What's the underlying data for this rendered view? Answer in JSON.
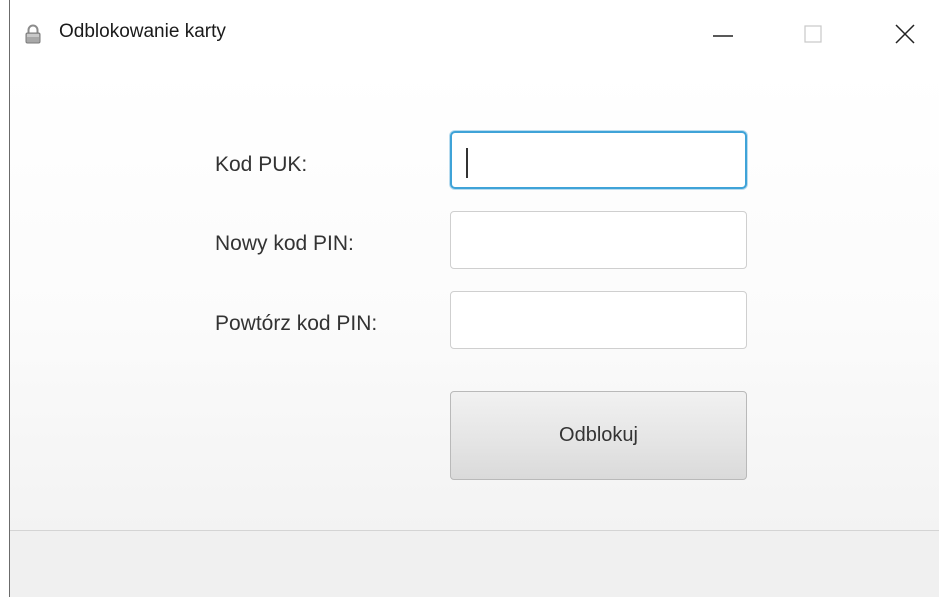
{
  "window": {
    "title": "Odblokowanie karty",
    "icon": "padlock-icon",
    "controls": {
      "minimize": "minimize-icon",
      "maximize": "maximize-icon",
      "close": "close-icon"
    }
  },
  "form": {
    "puk_label": "Kod PUK:",
    "puk_value": "",
    "new_pin_label": "Nowy kod PIN:",
    "new_pin_value": "",
    "repeat_pin_label": "Powtórz kod PIN:",
    "repeat_pin_value": "",
    "submit_label": "Odblokuj"
  },
  "colors": {
    "focus_border": "#3fa3d8",
    "window_border": "#6b6b6b"
  }
}
